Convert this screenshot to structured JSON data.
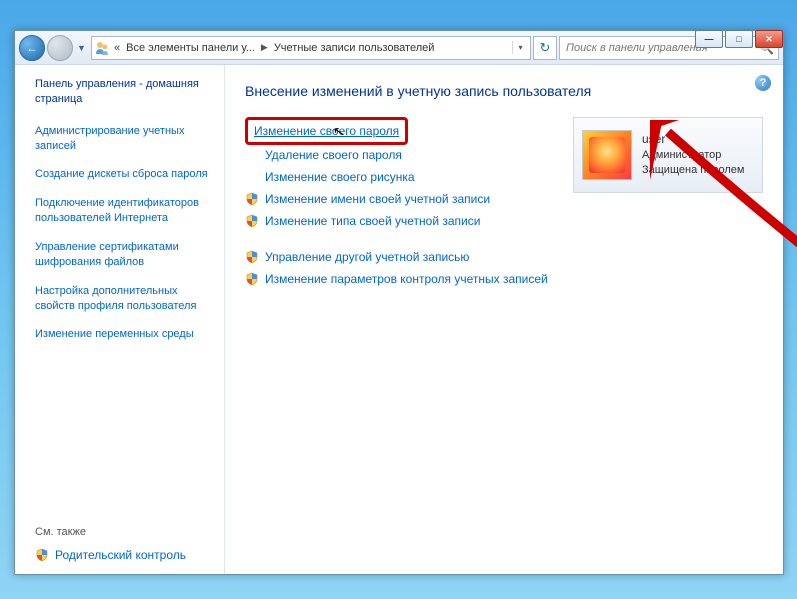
{
  "window_controls": {
    "minimize": "—",
    "maximize": "□",
    "close": "✕"
  },
  "nav": {
    "back_glyph": "←",
    "forward_glyph": "→",
    "history_glyph": "▼",
    "refresh_glyph": "↻"
  },
  "breadcrumb": {
    "prefix": "«",
    "seg1": "Все элементы панели у...",
    "seg2": "Учетные записи пользователей",
    "dd_glyph": "▾"
  },
  "search": {
    "placeholder": "Поиск в панели управления",
    "icon_glyph": "🔍"
  },
  "help": {
    "glyph": "?"
  },
  "sidebar": {
    "head": "Панель управления - домашняя страница",
    "links": [
      "Администрирование учетных записей",
      "Создание дискеты сброса пароля",
      "Подключение идентификаторов пользователей Интернета",
      "Управление сертификатами шифрования файлов",
      "Настройка дополнительных свойств профиля пользователя",
      "Изменение переменных среды"
    ],
    "see_also": "См. также",
    "parental": "Родительский контроль"
  },
  "main": {
    "title": "Внесение изменений в учетную запись пользователя",
    "links": {
      "change_password": "Изменение своего пароля",
      "delete_password": "Удаление своего пароля",
      "change_picture": "Изменение своего рисунка",
      "change_name": "Изменение имени своей учетной записи",
      "change_type": "Изменение типа своей учетной записи",
      "manage_other": "Управление другой учетной записью",
      "uac_settings": "Изменение параметров контроля учетных записей"
    }
  },
  "user": {
    "name": "user",
    "role": "Администратор",
    "protected": "Защищена паролем"
  },
  "cursor_glyph": "↖"
}
